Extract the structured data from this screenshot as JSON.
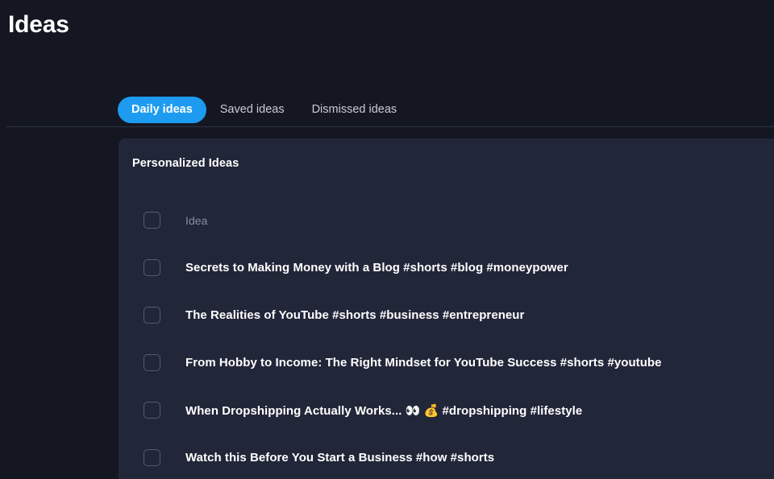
{
  "page": {
    "title": "Ideas",
    "background_color": "#141722"
  },
  "tabs": {
    "active_index": 0,
    "accent_color": "#1d9bf0",
    "items": [
      {
        "label": "Daily ideas",
        "active": true
      },
      {
        "label": "Saved ideas",
        "active": false
      },
      {
        "label": "Dismissed ideas",
        "active": false
      }
    ]
  },
  "panel": {
    "title": "Personalized Ideas",
    "background_color": "#222639",
    "column_header": {
      "label": "Idea",
      "checkbox_checked": false
    },
    "rows": [
      {
        "label": "Secrets to Making Money with a Blog #shorts #blog #moneypower",
        "checkbox_checked": false
      },
      {
        "label": "The Realities of YouTube #shorts #business #entrepreneur",
        "checkbox_checked": false
      },
      {
        "label": "From Hobby to Income: The Right Mindset for YouTube Success #shorts #youtube",
        "checkbox_checked": false
      },
      {
        "label": "When Dropshipping Actually Works... 👀 💰 #dropshipping #lifestyle",
        "checkbox_checked": false
      },
      {
        "label": "Watch this Before You Start a Business #how #shorts",
        "checkbox_checked": false
      }
    ]
  }
}
